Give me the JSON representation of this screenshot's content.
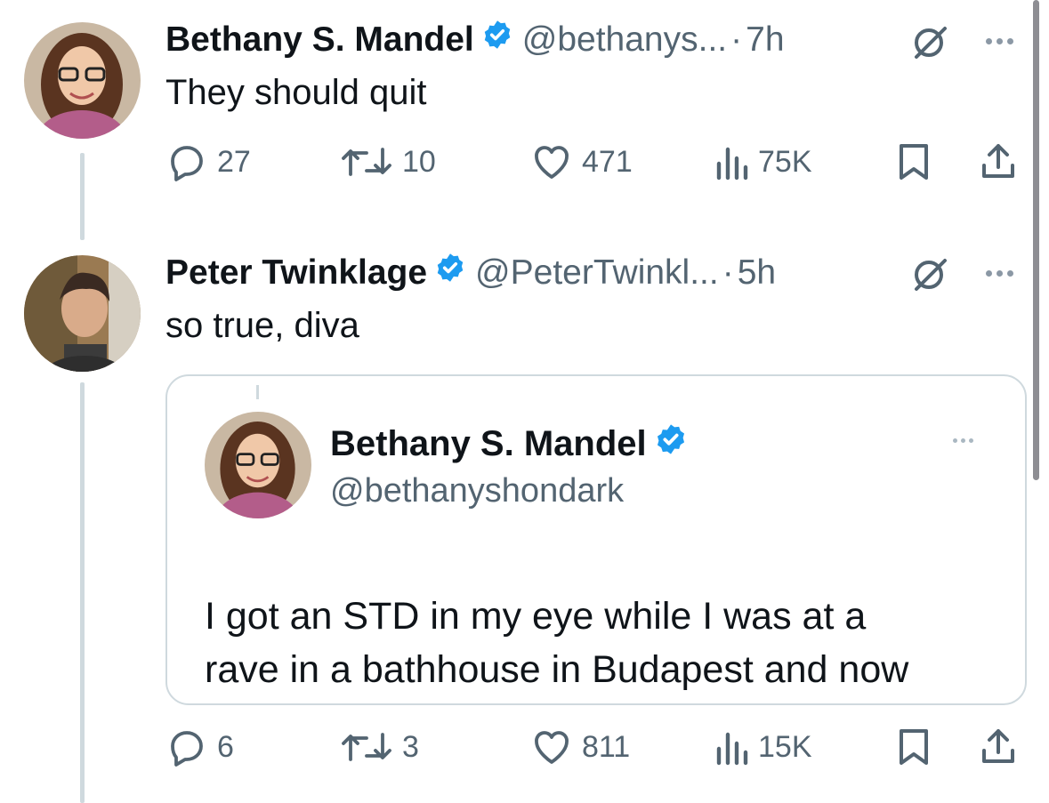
{
  "tweets": [
    {
      "name": "Bethany S. Mandel",
      "handle": "@bethanys...",
      "time": "7h",
      "text": "They should quit",
      "replies": "27",
      "reposts": "10",
      "likes": "471",
      "views": "75K"
    },
    {
      "name": "Peter Twinklage",
      "handle": "@PeterTwinkl...",
      "time": "5h",
      "text": "so true, diva",
      "replies": "6",
      "reposts": "3",
      "likes": "811",
      "views": "15K",
      "quote": {
        "name": "Bethany S. Mandel",
        "handle": "@bethanyshondark",
        "text_line1": "I got an STD in my eye while I was at a",
        "text_line2": "rave in a bathhouse in Budapest and now"
      }
    }
  ],
  "separator": "·",
  "colors": {
    "verified": "#1d9bf0",
    "muted": "#536471",
    "thread_line": "#cfd9de"
  },
  "icons": [
    "verified-badge-icon",
    "grok-icon",
    "more-icon",
    "reply-icon",
    "repost-icon",
    "like-icon",
    "views-icon",
    "bookmark-icon",
    "share-icon"
  ]
}
